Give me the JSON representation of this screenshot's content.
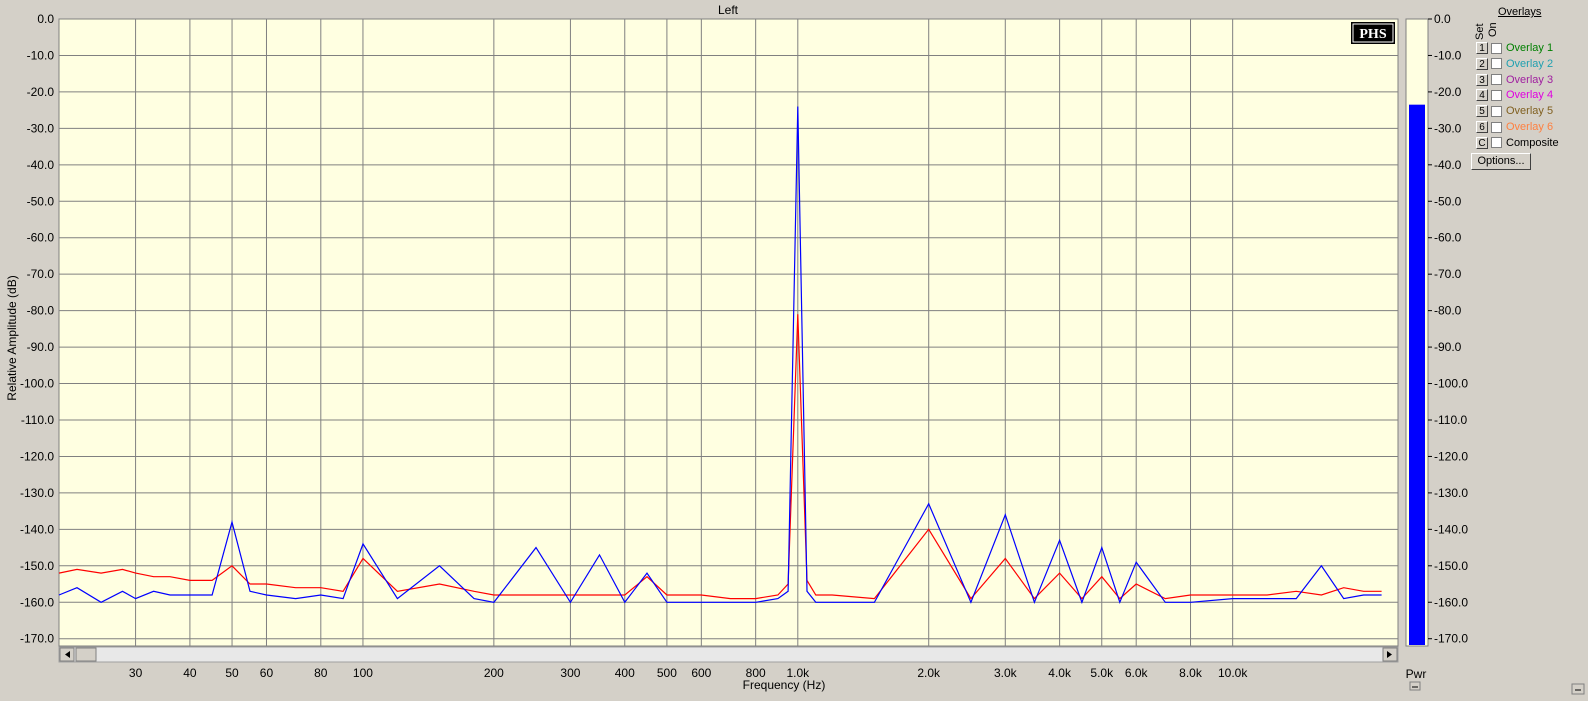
{
  "chart_data": {
    "type": "line",
    "title": "Left",
    "xlabel": "Frequency (Hz)",
    "ylabel": "Relative Amplitude (dB)",
    "x_scale": "log",
    "xlim": [
      20,
      24000
    ],
    "ylim": [
      -172,
      0
    ],
    "x_ticks": [
      30,
      40,
      50,
      60,
      80,
      100,
      200,
      300,
      400,
      500,
      600,
      800,
      1000,
      2000,
      3000,
      4000,
      5000,
      6000,
      8000,
      10000
    ],
    "x_tick_labels": [
      "30",
      "40",
      "50",
      "60",
      "80",
      "100",
      "200",
      "300",
      "400",
      "500",
      "600",
      "800",
      "1.0k",
      "2.0k",
      "3.0k",
      "4.0k",
      "5.0k",
      "6.0k",
      "8.0k",
      "10.0k"
    ],
    "y_ticks": [
      0,
      -10,
      -20,
      -30,
      -40,
      -50,
      -60,
      -70,
      -80,
      -90,
      -100,
      -110,
      -120,
      -130,
      -140,
      -150,
      -160,
      -170
    ],
    "y_tick_labels": [
      "0.0",
      "-10.0",
      "-20.0",
      "-30.0",
      "-40.0",
      "-50.0",
      "-60.0",
      "-70.0",
      "-80.0",
      "-90.0",
      "-100.0",
      "-110.0",
      "-120.0",
      "-130.0",
      "-140.0",
      "-150.0",
      "-160.0",
      "-170.0"
    ],
    "grid": true,
    "series": [
      {
        "color": "#ff0000",
        "x": [
          20,
          22,
          25,
          28,
          30,
          33,
          36,
          40,
          45,
          50,
          55,
          60,
          70,
          80,
          90,
          100,
          120,
          150,
          180,
          200,
          250,
          300,
          350,
          400,
          450,
          500,
          600,
          700,
          800,
          900,
          950,
          1000,
          1050,
          1100,
          1200,
          1500,
          2000,
          2500,
          3000,
          3500,
          4000,
          4500,
          5000,
          5500,
          6000,
          7000,
          8000,
          10000,
          12000,
          14000,
          16000,
          18000,
          20000,
          22000
        ],
        "y": [
          -152,
          -151,
          -152,
          -151,
          -152,
          -153,
          -153,
          -154,
          -154,
          -150,
          -155,
          -155,
          -156,
          -156,
          -157,
          -148,
          -157,
          -155,
          -157,
          -158,
          -158,
          -158,
          -158,
          -158,
          -153,
          -158,
          -158,
          -159,
          -159,
          -158,
          -155,
          -81,
          -154,
          -158,
          -158,
          -159,
          -140,
          -159,
          -148,
          -159,
          -152,
          -159,
          -153,
          -159,
          -155,
          -159,
          -158,
          -158,
          -158,
          -157,
          -158,
          -156,
          -157,
          -157
        ]
      },
      {
        "color": "#0000ff",
        "x": [
          20,
          22,
          25,
          28,
          30,
          33,
          36,
          40,
          45,
          50,
          55,
          60,
          70,
          80,
          90,
          100,
          120,
          150,
          180,
          200,
          250,
          300,
          350,
          400,
          450,
          500,
          600,
          700,
          800,
          900,
          950,
          1000,
          1050,
          1100,
          1200,
          1500,
          2000,
          2500,
          3000,
          3500,
          4000,
          4500,
          5000,
          5500,
          6000,
          7000,
          8000,
          10000,
          12000,
          14000,
          16000,
          18000,
          20000,
          22000
        ],
        "y": [
          -158,
          -156,
          -160,
          -157,
          -159,
          -157,
          -158,
          -158,
          -158,
          -138,
          -157,
          -158,
          -159,
          -158,
          -159,
          -144,
          -159,
          -150,
          -159,
          -160,
          -145,
          -160,
          -147,
          -160,
          -152,
          -160,
          -160,
          -160,
          -160,
          -159,
          -157,
          -24,
          -157,
          -160,
          -160,
          -160,
          -133,
          -160,
          -136,
          -160,
          -143,
          -160,
          -145,
          -160,
          -149,
          -160,
          -160,
          -159,
          -159,
          -159,
          -150,
          -159,
          -158,
          -158
        ]
      }
    ]
  },
  "meter": {
    "label": "Pwr",
    "level_db": -23.5,
    "y_tick_labels": [
      "0.0",
      "-10.0",
      "-20.0",
      "-30.0",
      "-40.0",
      "-50.0",
      "-60.0",
      "-70.0",
      "-80.0",
      "-90.0",
      "-100.0",
      "-110.0",
      "-120.0",
      "-130.0",
      "-140.0",
      "-150.0",
      "-160.0",
      "-170.0"
    ]
  },
  "logo": "PHS",
  "overlays": {
    "title": "Overlays",
    "set_header": "Set",
    "on_header": "On",
    "items": [
      {
        "set": "1",
        "label": "Overlay 1",
        "color": "#008000"
      },
      {
        "set": "2",
        "label": "Overlay 2",
        "color": "#20a0b0"
      },
      {
        "set": "3",
        "label": "Overlay 3",
        "color": "#a020a0"
      },
      {
        "set": "4",
        "label": "Overlay 4",
        "color": "#e000e0"
      },
      {
        "set": "5",
        "label": "Overlay 5",
        "color": "#806020"
      },
      {
        "set": "6",
        "label": "Overlay 6",
        "color": "#ff8040"
      },
      {
        "set": "C",
        "label": "Composite",
        "color": "#000000"
      }
    ],
    "options_label": "Options..."
  }
}
